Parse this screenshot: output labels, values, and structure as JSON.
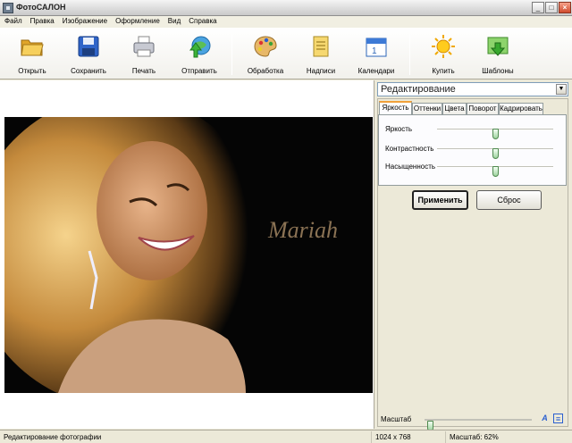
{
  "window": {
    "title": "ФотоСАЛОН"
  },
  "menu": [
    "Файл",
    "Правка",
    "Изображение",
    "Оформление",
    "Вид",
    "Справка"
  ],
  "toolbar": {
    "open": "Открыть",
    "save": "Сохранить",
    "print": "Печать",
    "send": "Отправить",
    "process": "Обработка",
    "captions": "Надписи",
    "calendars": "Календари",
    "buy": "Купить",
    "templates": "Шаблоны"
  },
  "photo": {
    "signature": "Mariah"
  },
  "panel": {
    "mode": "Редактирование",
    "tabs": [
      "Яркость",
      "Оттенки",
      "Цвета",
      "Поворот",
      "Кадрировать"
    ],
    "active_tab": "Яркость",
    "sliders": [
      {
        "label": "Яркость",
        "value": 0.5
      },
      {
        "label": "Контрастность",
        "value": 0.5
      },
      {
        "label": "Насыщенность",
        "value": 0.5
      }
    ],
    "apply_label": "Применить",
    "reset_label": "Сброс"
  },
  "zoom": {
    "label": "Масштаб",
    "value": 0.05
  },
  "status": {
    "mode": "Редактирование фотографии",
    "dimensions": "1024 x 768",
    "zoom": "Масштаб: 62%"
  },
  "colors": {
    "accent_tab": "#f1a13a",
    "thumb": "#9ed39e"
  }
}
